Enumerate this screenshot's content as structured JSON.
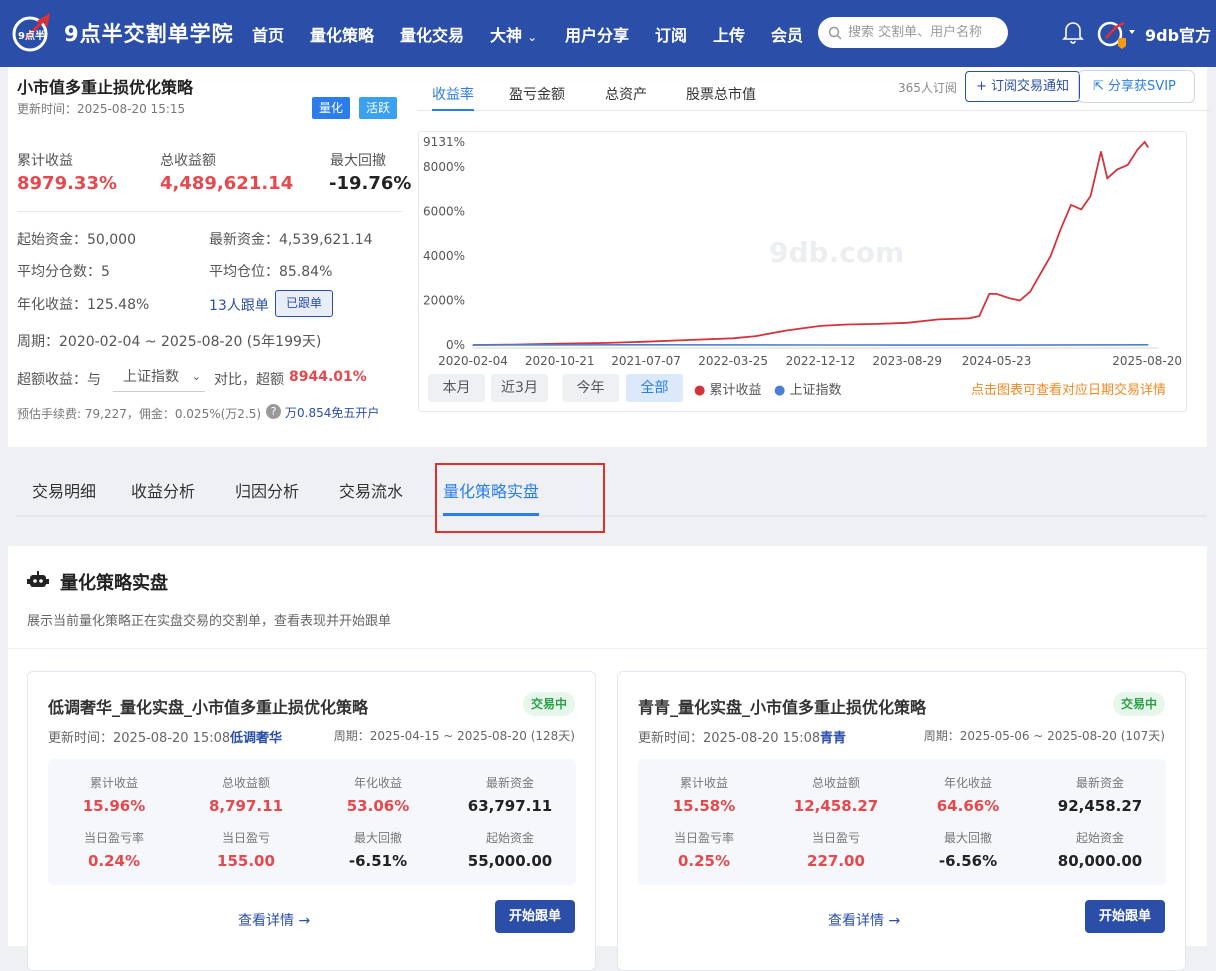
{
  "nav": {
    "logo_badge_text": "9点半",
    "site_title": "9点半交割单学院",
    "items": [
      "首页",
      "量化策略",
      "量化交易",
      "大神",
      "用户分享",
      "订阅",
      "上传",
      "会员"
    ],
    "search_placeholder": "搜索 交割单、用户名称",
    "user_name": "9db官方"
  },
  "strategy": {
    "title": "小市值多重止损优化策略",
    "update_time": "更新时间：2025-08-20 15:15",
    "tags": [
      "量化",
      "活跃"
    ],
    "kpis": [
      {
        "label": "累计收益",
        "value": "8979.33%"
      },
      {
        "label": "总收益额",
        "value": "4,489,621.14"
      },
      {
        "label": "最大回撤",
        "value": "-19.76%"
      }
    ],
    "start_capital": "起始资金：50,000",
    "latest_capital": "最新资金：4,539,621.14",
    "avg_positions": "平均分仓数：5",
    "avg_position_ratio": "平均仓位：85.84%",
    "annual_return": "年化收益：125.48%",
    "followers": "13人跟单",
    "followed_label": "已跟单",
    "period": "周期：2020-02-04 ~ 2025-08-20 (5年199天)",
    "excess_prefix": "超额收益：与",
    "benchmark_select": "上证指数",
    "excess_middle": "对比，超额",
    "excess_value": "8944.01%",
    "fee_text": "预估手续费: 79,227，佣金：0.025%(万2.5)",
    "fee_link": "万0.854免五开户"
  },
  "chart_header": {
    "tabs": [
      "收益率",
      "盈亏金额",
      "总资产",
      "股票总市值"
    ],
    "subscribers": "365人订阅",
    "subscribe_btn": "+ 订阅交易通知",
    "share_btn": "分享获SVIP"
  },
  "chart_data": {
    "type": "line",
    "ymax_label": "9131%",
    "ylim": [
      0,
      9131
    ],
    "y_ticks": [
      "8000%",
      "6000%",
      "4000%",
      "2000%",
      "0%"
    ],
    "y_tick_values": [
      8000,
      6000,
      4000,
      2000,
      0
    ],
    "x_ticks": [
      "2020-02-04",
      "2020-10-21",
      "2021-07-07",
      "2022-03-25",
      "2022-12-12",
      "2023-08-29",
      "2024-05-23",
      "2025-08-20"
    ],
    "x_tick_dates": [
      "2020-02-04",
      "2020-10-21",
      "2021-07-07",
      "2022-03-25",
      "2022-12-12",
      "2023-08-29",
      "2024-05-23",
      "2025-08-20"
    ],
    "xlim": [
      "2020-02-04",
      "2025-08-20"
    ],
    "series": [
      {
        "name": "累计收益",
        "color": "#d1343b",
        "points": [
          [
            "2020-02-04",
            0
          ],
          [
            "2020-06-01",
            20
          ],
          [
            "2020-10-21",
            60
          ],
          [
            "2021-03-01",
            90
          ],
          [
            "2021-07-07",
            150
          ],
          [
            "2021-11-01",
            220
          ],
          [
            "2022-03-25",
            300
          ],
          [
            "2022-06-01",
            400
          ],
          [
            "2022-09-01",
            650
          ],
          [
            "2022-12-12",
            860
          ],
          [
            "2023-03-01",
            920
          ],
          [
            "2023-06-01",
            950
          ],
          [
            "2023-08-29",
            1000
          ],
          [
            "2023-12-01",
            1150
          ],
          [
            "2024-03-01",
            1200
          ],
          [
            "2024-04-01",
            1300
          ],
          [
            "2024-05-01",
            2300
          ],
          [
            "2024-05-23",
            2300
          ],
          [
            "2024-07-01",
            2100
          ],
          [
            "2024-08-01",
            2000
          ],
          [
            "2024-09-01",
            2400
          ],
          [
            "2024-10-01",
            3200
          ],
          [
            "2024-11-01",
            4000
          ],
          [
            "2024-12-01",
            5200
          ],
          [
            "2025-01-01",
            6300
          ],
          [
            "2025-02-01",
            6100
          ],
          [
            "2025-03-01",
            6700
          ],
          [
            "2025-04-01",
            8700
          ],
          [
            "2025-04-20",
            7500
          ],
          [
            "2025-05-20",
            7900
          ],
          [
            "2025-06-20",
            8100
          ],
          [
            "2025-07-20",
            8800
          ],
          [
            "2025-08-10",
            9131
          ],
          [
            "2025-08-20",
            8900
          ]
        ]
      },
      {
        "name": "上证指数",
        "color": "#4a7fd4",
        "points": [
          [
            "2020-02-04",
            0
          ],
          [
            "2021-07-07",
            10
          ],
          [
            "2022-12-12",
            -2
          ],
          [
            "2024-05-23",
            -5
          ],
          [
            "2025-08-20",
            8
          ]
        ]
      }
    ],
    "watermark": "9db.com"
  },
  "range_buttons": [
    "本月",
    "近3月",
    "今年",
    "全部"
  ],
  "chart_hint": "点击图表可查看对应日期交易详情",
  "main_tabs": [
    "交易明细",
    "收益分析",
    "归因分析",
    "交易流水",
    "量化策略实盘"
  ],
  "section": {
    "title": "量化策略实盘",
    "desc": "展示当前量化策略正在实盘交易的交割单，查看表现并开始跟单"
  },
  "cards": [
    {
      "title": "低调奢华_量化实盘_小市值多重止损优化策略",
      "status": "交易中",
      "update_time": "更新时间：2025-08-20 15:08",
      "author": "低调奢华",
      "period": "周期：2025-04-15 ~ 2025-08-20 (128天)",
      "metrics": [
        {
          "label": "累计收益",
          "value": "15.96%"
        },
        {
          "label": "总收益额",
          "value": "8,797.11"
        },
        {
          "label": "年化收益",
          "value": "53.06%"
        },
        {
          "label": "最新资金",
          "value": "63,797.11"
        },
        {
          "label": "当日盈亏率",
          "value": "0.24%"
        },
        {
          "label": "当日盈亏",
          "value": "155.00"
        },
        {
          "label": "最大回撤",
          "value": "-6.51%"
        },
        {
          "label": "起始资金",
          "value": "55,000.00"
        }
      ],
      "detail_link": "查看详情",
      "start_btn": "开始跟单"
    },
    {
      "title": "青青_量化实盘_小市值多重止损优化策略",
      "status": "交易中",
      "update_time": "更新时间：2025-08-20 15:08",
      "author": "青青",
      "period": "周期：2025-05-06 ~ 2025-08-20 (107天)",
      "metrics": [
        {
          "label": "累计收益",
          "value": "15.58%"
        },
        {
          "label": "总收益额",
          "value": "12,458.27"
        },
        {
          "label": "年化收益",
          "value": "64.66%"
        },
        {
          "label": "最新资金",
          "value": "92,458.27"
        },
        {
          "label": "当日盈亏率",
          "value": "0.25%"
        },
        {
          "label": "当日盈亏",
          "value": "227.00"
        },
        {
          "label": "最大回撤",
          "value": "-6.56%"
        },
        {
          "label": "起始资金",
          "value": "80,000.00"
        }
      ],
      "detail_link": "查看详情",
      "start_btn": "开始跟单"
    }
  ]
}
